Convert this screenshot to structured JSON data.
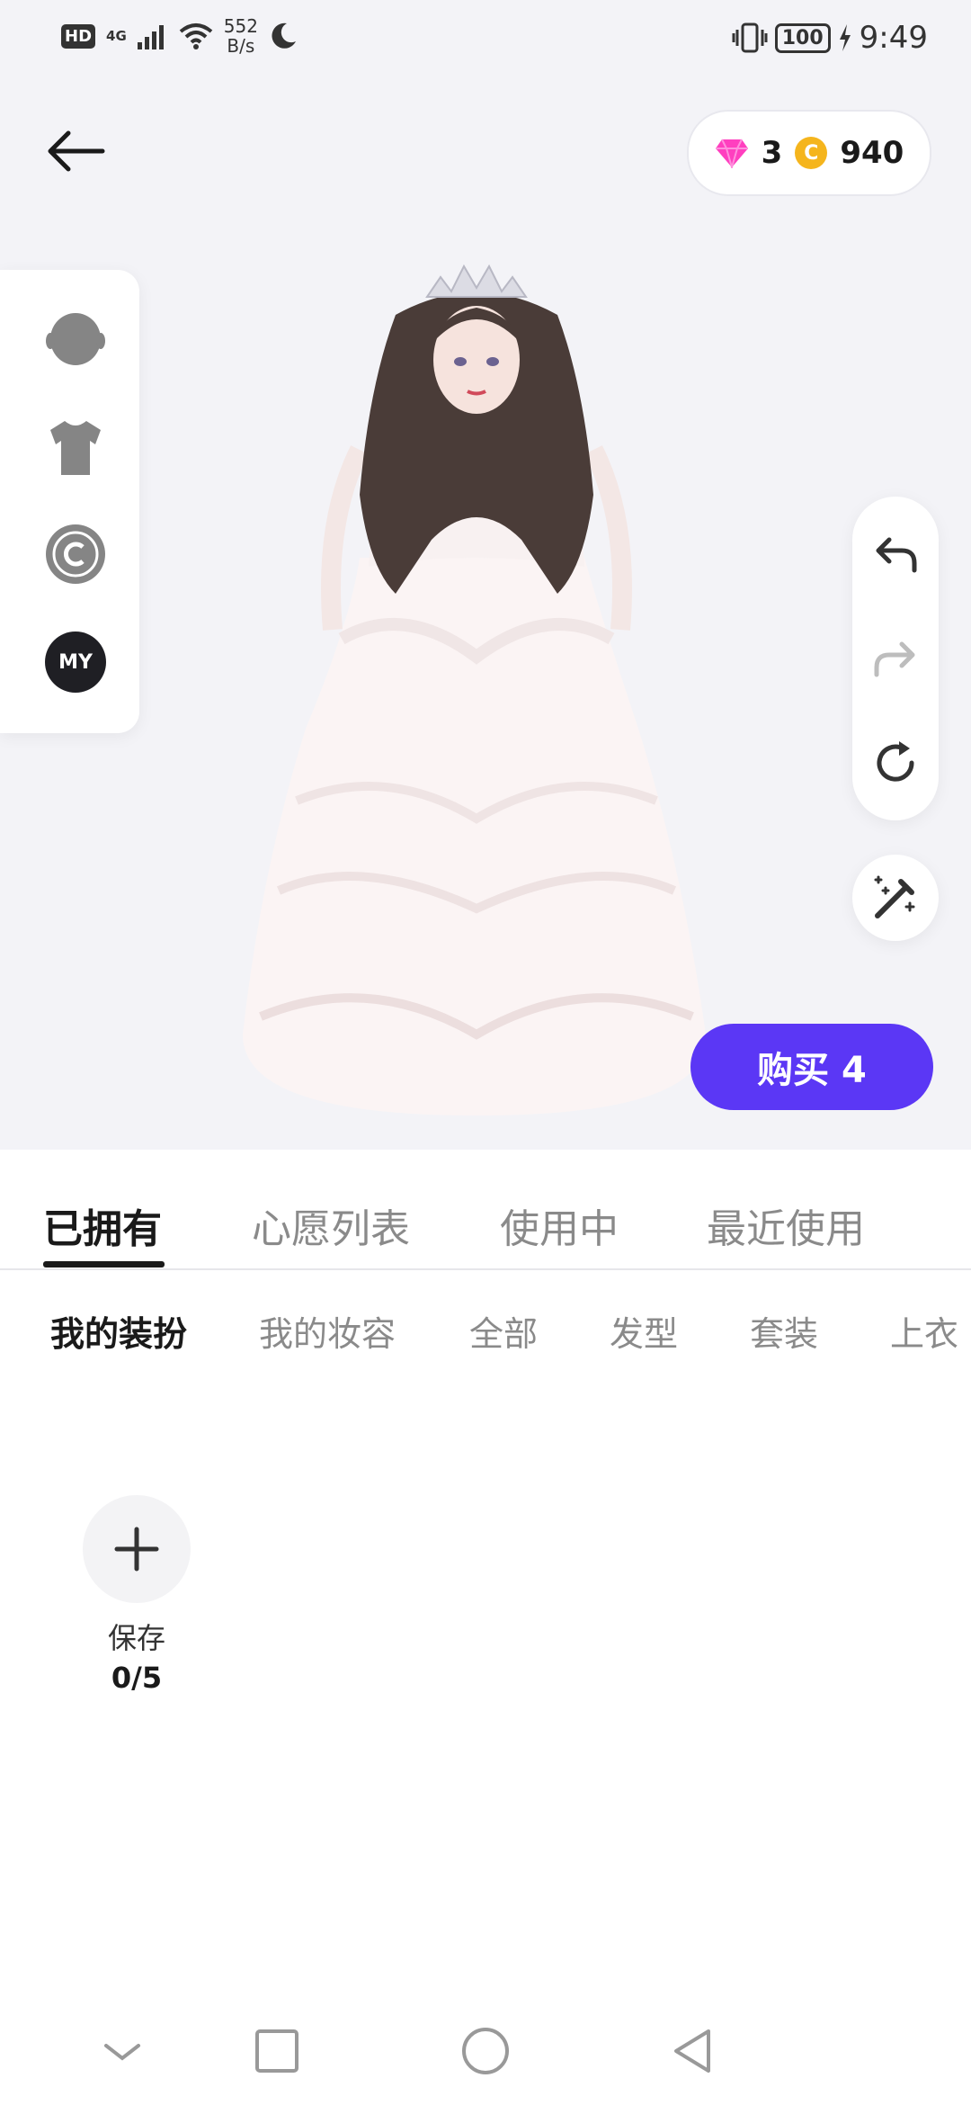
{
  "status_bar": {
    "network": "HD",
    "signal": "4G",
    "speed_value": "552",
    "speed_unit": "B/s",
    "battery": "100",
    "time": "9:49"
  },
  "currency": {
    "gems": "3",
    "coins": "940",
    "coin_symbol": "C"
  },
  "rail": {
    "my_label": "MY"
  },
  "buy_button": {
    "label": "购买 4"
  },
  "tabs": [
    {
      "label": "已拥有"
    },
    {
      "label": "心愿列表"
    },
    {
      "label": "使用中"
    },
    {
      "label": "最近使用"
    }
  ],
  "subtabs": [
    {
      "label": "我的装扮"
    },
    {
      "label": "我的妆容"
    },
    {
      "label": "全部"
    },
    {
      "label": "发型"
    },
    {
      "label": "套装"
    },
    {
      "label": "上衣"
    }
  ],
  "save_slot": {
    "label": "保存",
    "count": "0/5"
  },
  "colors": {
    "accent": "#5b37f5",
    "gem": "#ff3fbf",
    "coin": "#f5b51d"
  }
}
